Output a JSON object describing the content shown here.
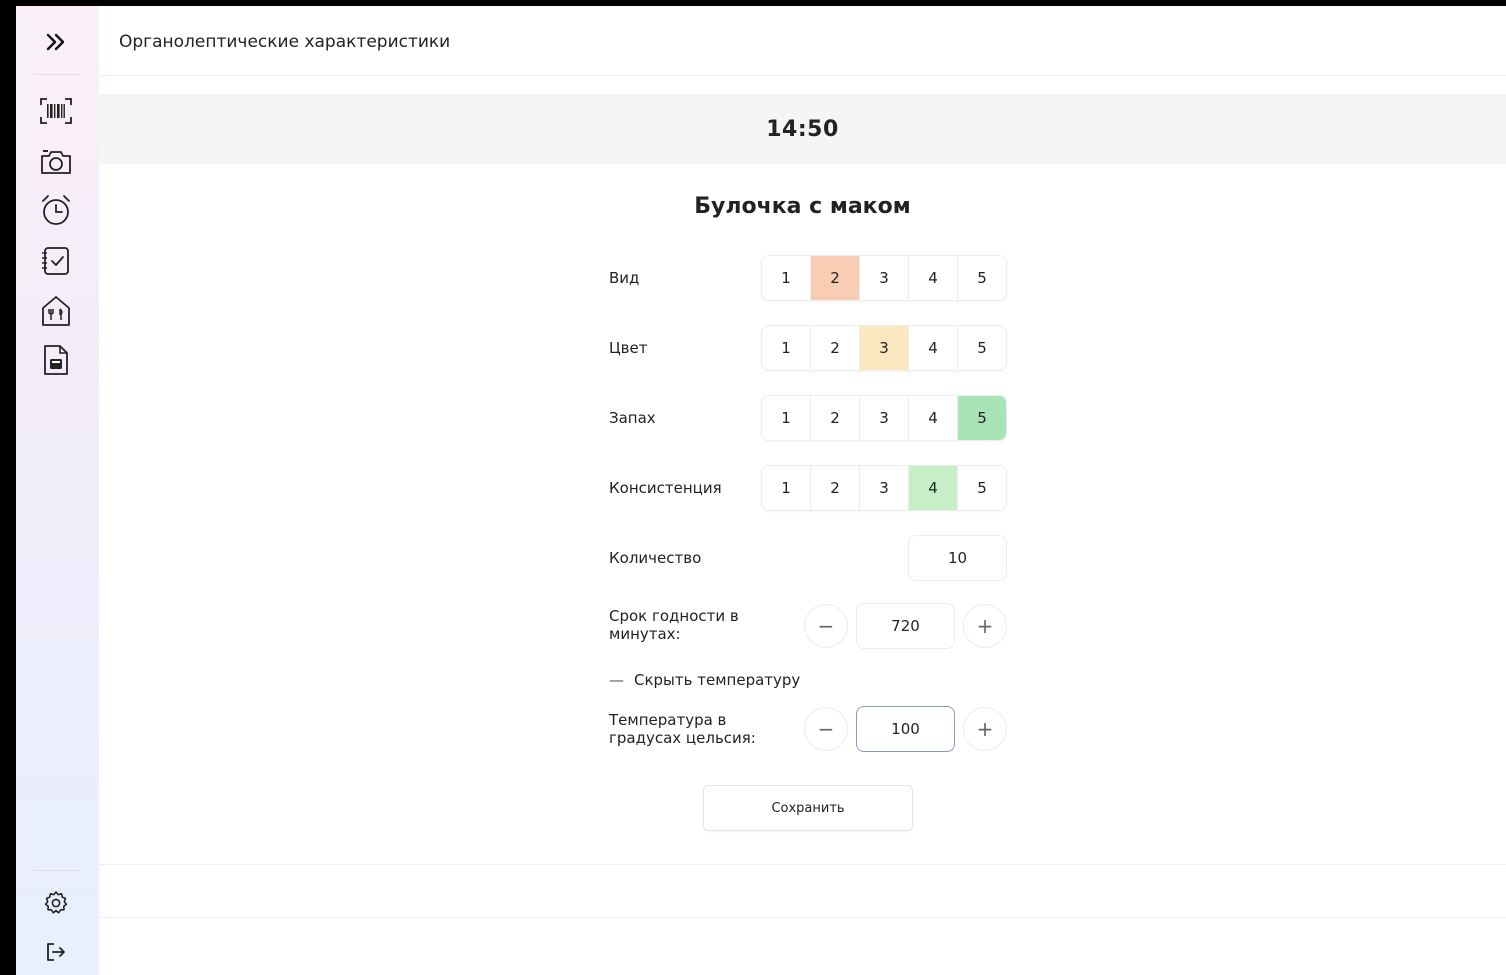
{
  "header": {
    "title": "Органолептические характеристики"
  },
  "time": "14:50",
  "product": {
    "name": "Булочка с маком"
  },
  "ratings": [
    {
      "label": "Вид",
      "options": [
        "1",
        "2",
        "3",
        "4",
        "5"
      ],
      "selected": 2,
      "color": "#f8cdb4"
    },
    {
      "label": "Цвет",
      "options": [
        "1",
        "2",
        "3",
        "4",
        "5"
      ],
      "selected": 3,
      "color": "#fbe7c0"
    },
    {
      "label": "Запах",
      "options": [
        "1",
        "2",
        "3",
        "4",
        "5"
      ],
      "selected": 5,
      "color": "#a8e5b6"
    },
    {
      "label": "Консистенция",
      "options": [
        "1",
        "2",
        "3",
        "4",
        "5"
      ],
      "selected": 4,
      "color": "#c6efc8"
    }
  ],
  "quantity": {
    "label": "Количество",
    "value": "10"
  },
  "shelf_life": {
    "label_line1": "Срок годности в",
    "label_line2": "минутах:",
    "value": "720",
    "minus": "−",
    "plus": "+"
  },
  "temperature_toggle": {
    "dash": "—",
    "label": "Скрыть температуру"
  },
  "temperature": {
    "label_line1": "Температура в",
    "label_line2": "градусах цельсия:",
    "value": "100",
    "minus": "−",
    "plus": "+"
  },
  "save_label": "Сохранить",
  "sidebar": {
    "icons": [
      "expand-icon",
      "barcode-icon",
      "camera-icon",
      "alarm-clock-icon",
      "checklist-icon",
      "restaurant-icon",
      "document-icon",
      "settings-icon",
      "logout-icon"
    ]
  }
}
